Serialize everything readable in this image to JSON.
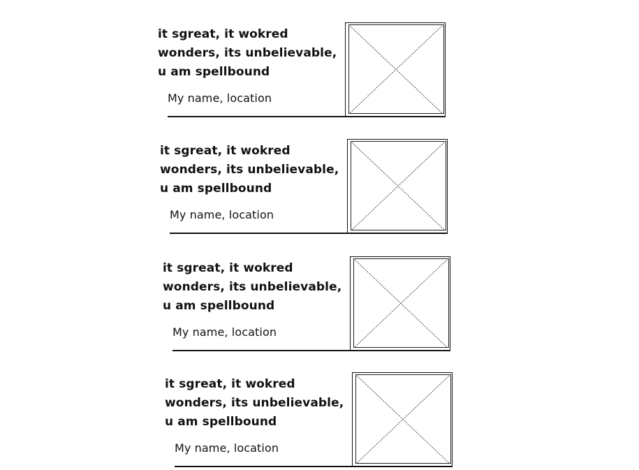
{
  "testimonials": [
    {
      "quote_lines": [
        "it sgreat, it wokred",
        "wonders, its unbelievable,",
        "u am spellbound"
      ],
      "author": "My name, location",
      "image_icon": "image-placeholder-icon"
    },
    {
      "quote_lines": [
        "it sgreat, it wokred",
        "wonders, its unbelievable,",
        "u am spellbound"
      ],
      "author": "My name, location",
      "image_icon": "image-placeholder-icon"
    },
    {
      "quote_lines": [
        "it sgreat, it wokred",
        "wonders, its unbelievable,",
        "u am spellbound"
      ],
      "author": "My name, location",
      "image_icon": "image-placeholder-icon"
    },
    {
      "quote_lines": [
        "it sgreat, it wokred",
        "wonders, its unbelievable,",
        "u am spellbound"
      ],
      "author": "My name, location",
      "image_icon": "image-placeholder-icon"
    }
  ],
  "colors": {
    "background": "#ffffff",
    "ink": "#111111"
  }
}
